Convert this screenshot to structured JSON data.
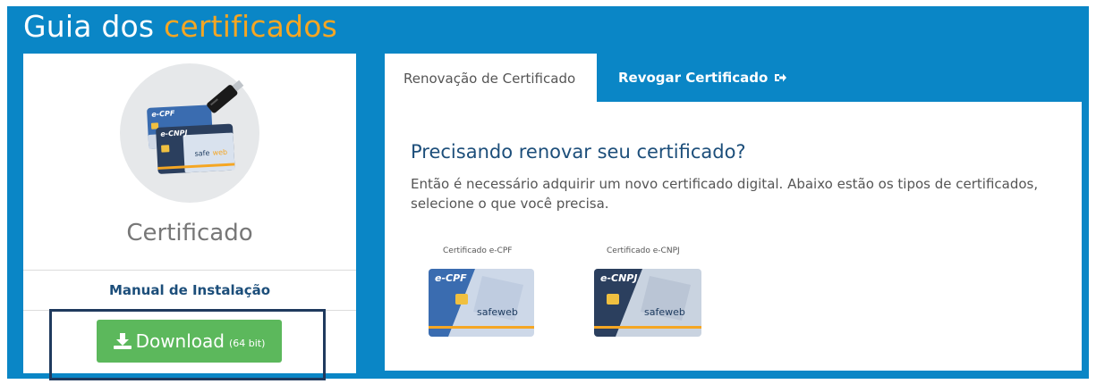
{
  "header": {
    "title_part1": "Guia dos",
    "title_part2": "certificados"
  },
  "left_panel": {
    "icon": "certificate-cards-usb-token-icon",
    "certificate_name": "Certificado",
    "manual_link": "Manual de Instalação",
    "download_button": {
      "label": "Download",
      "architecture": "(64 bit)",
      "icon": "download-icon"
    }
  },
  "tabs": [
    {
      "label": "Renovação de Certificado",
      "active": true
    },
    {
      "label": "Revogar Certificado",
      "active": false,
      "icon": "sign-out-icon"
    }
  ],
  "content": {
    "title": "Precisando renovar seu certificado?",
    "description": "Então é necessário adquirir um novo certificado digital. Abaixo estão os tipos de certificados, selecione o que você precisa.",
    "certificates": [
      {
        "caption": "Certificado e-CPF",
        "card_brand": "e-CPF",
        "vendor": "safeweb",
        "card_color": "#3a6cb0"
      },
      {
        "caption": "Certificado e-CNPJ",
        "card_brand": "e-CNPJ",
        "vendor": "safeweb",
        "card_color": "#2b3f5e"
      }
    ]
  },
  "colors": {
    "background": "#0a86c6",
    "accent": "#f5a623",
    "link": "#1c4e7a",
    "download": "#5cb85c",
    "highlight_border": "#1f3a5e"
  }
}
